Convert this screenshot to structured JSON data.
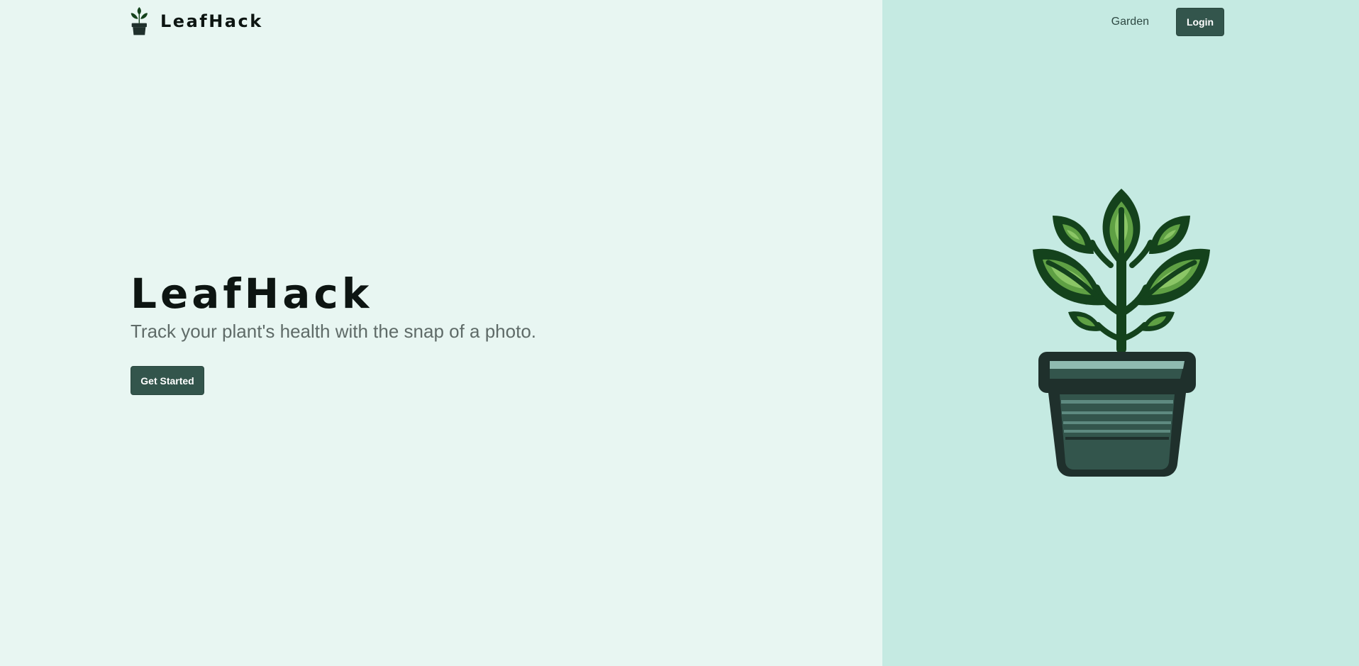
{
  "nav": {
    "brand_name": "LeafHack",
    "brand_logo_icon": "potted-plant-icon",
    "links": [
      {
        "label": "Garden"
      }
    ],
    "login_label": "Login"
  },
  "hero": {
    "title": "LeafHack",
    "subtitle": "Track your plant's health with the snap of a photo.",
    "cta_label": "Get Started"
  },
  "illustration": {
    "icon": "potted-plant-illustration"
  },
  "colors": {
    "left_background": "#e8f6f2",
    "right_background": "#c5eae2",
    "button": "#33554c",
    "leaf_dark": "#14421c",
    "leaf_mid": "#5fa044",
    "leaf_light": "#8bc666",
    "pot_dark": "#1f302c",
    "pot_mid": "#33554c",
    "pot_light": "#8fbab0"
  }
}
